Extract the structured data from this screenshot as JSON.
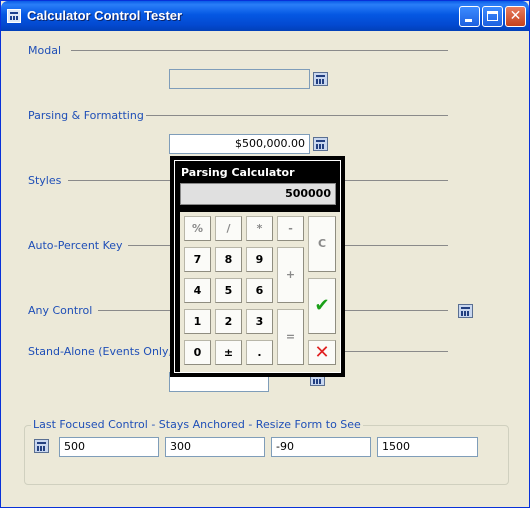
{
  "window": {
    "title": "Calculator Control Tester"
  },
  "sections": {
    "modal": "Modal",
    "parsing": "Parsing & Formatting",
    "styles": "Styles",
    "auto_percent": "Auto-Percent Key",
    "any_control": "Any Control",
    "stand_alone": "Stand-Alone (Events Only, n"
  },
  "fields": {
    "modal_value": "",
    "parsing_value": "$500,000.00",
    "stand_alone_value": ""
  },
  "group": {
    "label": "Last Focused Control - Stays Anchored - Resize Form to See",
    "values": [
      "500",
      "300",
      "-90",
      "1500"
    ]
  },
  "calculator": {
    "title": "Parsing Calculator",
    "display": "500000",
    "keys": {
      "percent": "%",
      "divide": "/",
      "multiply": "*",
      "minus": "-",
      "clear": "C",
      "seven": "7",
      "eight": "8",
      "nine": "9",
      "plus": "+",
      "four": "4",
      "five": "5",
      "six": "6",
      "one": "1",
      "two": "2",
      "three": "3",
      "equals": "=",
      "zero": "0",
      "plus_minus": "±",
      "decimal": ".",
      "ok": "✔",
      "cancel": "✕"
    }
  }
}
